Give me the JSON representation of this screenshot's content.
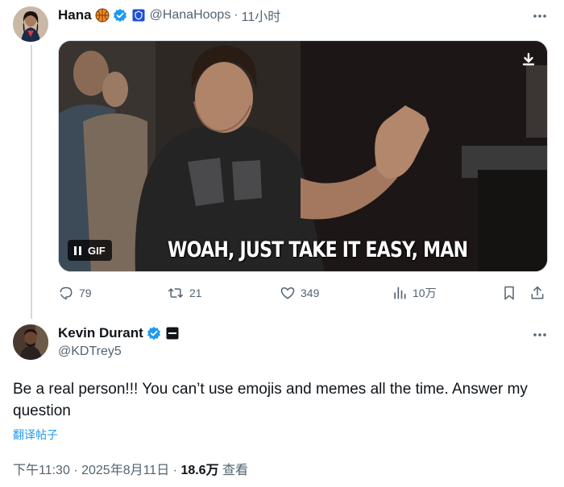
{
  "tweet1": {
    "display_name": "Hana",
    "name_emoji": "basketball-emoji",
    "handle": "@HanaHoops",
    "dot": "·",
    "time": "11小时",
    "media": {
      "type": "GIF",
      "caption": "WOAH, JUST TAKE IT EASY, MAN",
      "gif_label": "GIF"
    },
    "actions": {
      "replies": "79",
      "retweets": "21",
      "likes": "349",
      "views": "10万"
    }
  },
  "tweet2": {
    "display_name": "Kevin Durant",
    "handle": "@KDTrey5",
    "text": "Be a real person!!! You can’t use emojis and memes all the time. Answer my question",
    "translate": "翻译帖子",
    "meta": {
      "time": "下午11:30",
      "dot1": "·",
      "date": "2025年8月11日",
      "dot2": "·",
      "views": "18.6万",
      "views_label": "查看"
    }
  },
  "colors": {
    "verified_blue": "#1d9bf0",
    "secondary_text": "#536471",
    "link_blue": "#1d9bf0"
  }
}
